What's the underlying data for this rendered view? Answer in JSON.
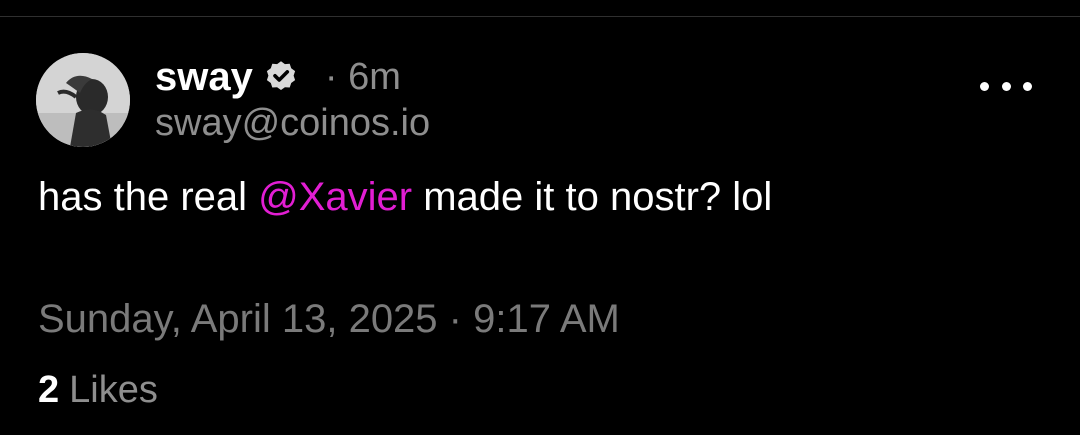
{
  "post": {
    "author": {
      "display_name": "sway",
      "handle": "sway@coinos.io",
      "verified": true
    },
    "time_ago": "· 6m",
    "text": {
      "before": "has the real ",
      "mention": "@Xavier",
      "after": " made it to nostr? lol"
    },
    "timestamp": "Sunday, April 13, 2025 · 9:17 AM",
    "likes": {
      "count": "2",
      "label": "Likes"
    }
  },
  "icons": {
    "verified": "verified-badge-icon",
    "more": "more-horizontal-icon",
    "avatar": "avatar-photo"
  },
  "colors": {
    "background": "#000000",
    "primary_text": "#ffffff",
    "secondary_text": "#8e8e8e",
    "mention": "#e21ed3"
  }
}
